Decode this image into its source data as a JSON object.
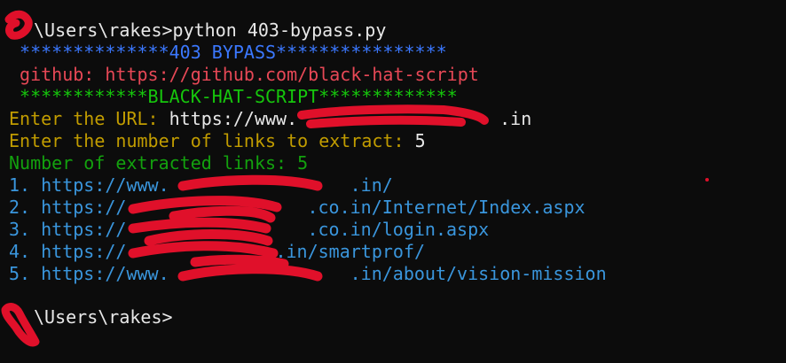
{
  "terminal": {
    "lines": [
      {
        "prompt": "\\Users\\rakes>",
        "command": "python 403-bypass.py"
      },
      {
        "text": " **************403 BYPASS****************"
      },
      {
        "text": " github: https://github.com/black-hat-script"
      },
      {
        "text": " ************BLACK-HAT-SCRIPT*************"
      },
      {
        "label": "Enter the URL: ",
        "value": "https://www.",
        "value_tail": ".in"
      },
      {
        "label": "Enter the number of links to extract: ",
        "value": "5"
      },
      {
        "text": "Number of extracted links: 5"
      },
      {
        "num": "1. ",
        "pre": "https://www.",
        "post": ".in/"
      },
      {
        "num": "2. ",
        "pre": "https://",
        "post": ".co.in/Internet/Index.aspx"
      },
      {
        "num": "3. ",
        "pre": "https://",
        "post": ".co.in/login.aspx"
      },
      {
        "num": "4. ",
        "pre": "https://",
        "post": ".in/smartprof/"
      },
      {
        "num": "5. ",
        "pre": "https://www.",
        "post": ".in/about/vision-mission"
      },
      {
        "prompt": "\\Users\\rakes>"
      }
    ],
    "colors": {
      "background": "#0c0c0c",
      "banner": "#3b78ff",
      "github": "#e74856",
      "signature": "#16c60c",
      "prompt_text": "#c19c00",
      "count_text": "#13a10e",
      "links": "#3a96dd",
      "redaction": "#e0102a"
    }
  }
}
